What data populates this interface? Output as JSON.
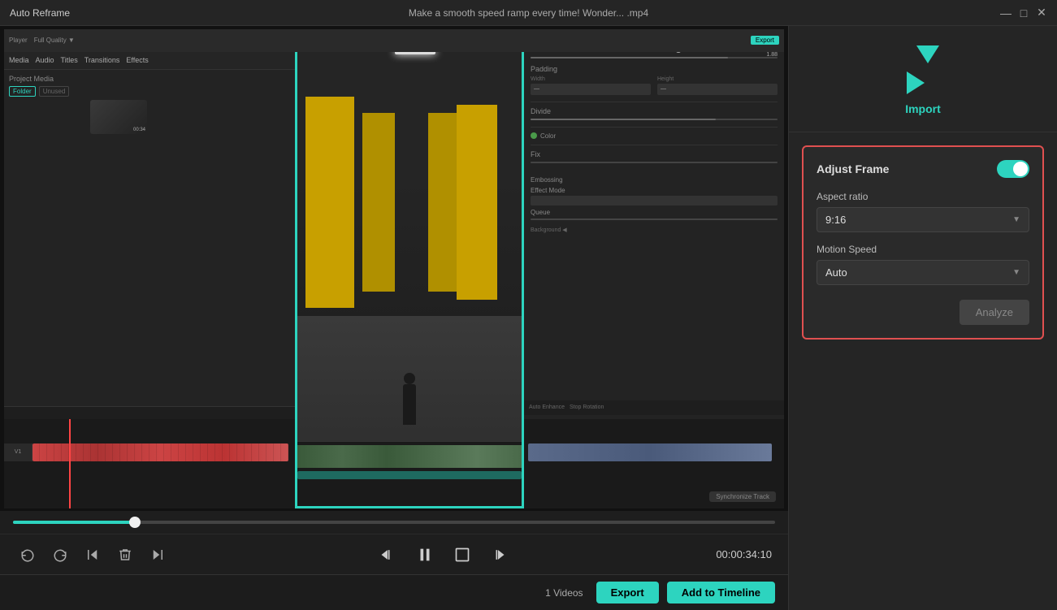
{
  "titleBar": {
    "appName": "Auto Reframe",
    "fileTitle": "Make a smooth speed ramp every time!  Wonder... .mp4",
    "controls": {
      "minimize": "—",
      "maximize": "□",
      "close": "✕"
    }
  },
  "import": {
    "label": "Import"
  },
  "adjustFrame": {
    "title": "Adjust Frame",
    "toggleEnabled": true,
    "aspectRatio": {
      "label": "Aspect ratio",
      "value": "9:16"
    },
    "motionSpeed": {
      "label": "Motion Speed",
      "value": "Auto"
    },
    "analyzeButton": "Analyze"
  },
  "bottomBar": {
    "videosCount": "1 Videos",
    "exportLabel": "Export",
    "addToTimelineLabel": "Add to Timeline"
  },
  "playback": {
    "timestamp": "00:00:34:10",
    "controls": {
      "undo": "↺",
      "redo": "↻",
      "skipBack": "⏮",
      "delete": "🗑",
      "skipForward": "⏭",
      "prevFrame": "⏮",
      "pause": "⏸",
      "fullscreen": "⛶",
      "nextFrame": "⏭"
    }
  }
}
